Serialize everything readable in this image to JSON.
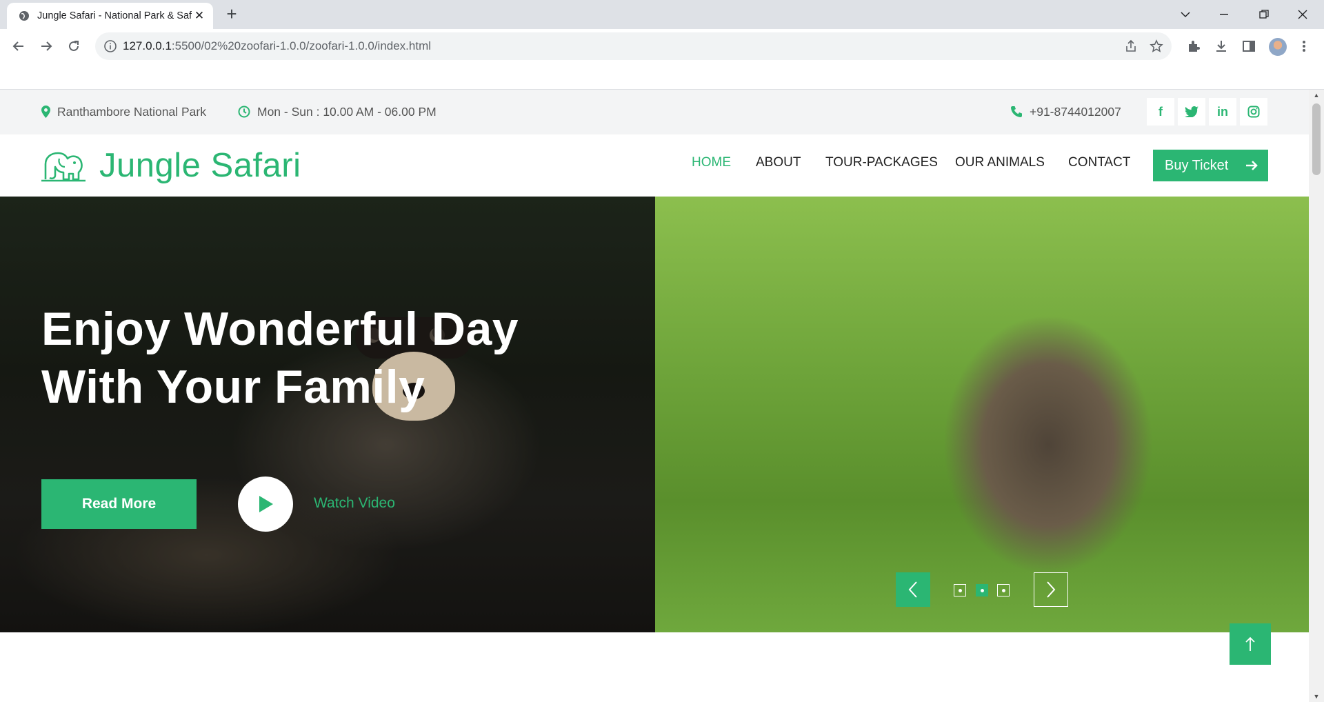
{
  "browser": {
    "tab_title": "Jungle Safari - National Park & Safari",
    "url_host": "127.0.0.1",
    "url_path": ":5500/02%20zoofari-1.0.0/zoofari-1.0.0/index.html"
  },
  "topbar": {
    "location": "Ranthambore National Park",
    "hours": "Mon - Sun : 10.00 AM - 06.00 PM",
    "phone": "+91-8744012007",
    "social": [
      {
        "icon": "facebook-icon",
        "glyph": "f"
      },
      {
        "icon": "twitter-icon",
        "glyph": ""
      },
      {
        "icon": "linkedin-icon",
        "glyph": "in"
      },
      {
        "icon": "instagram-icon",
        "glyph": ""
      }
    ]
  },
  "navbar": {
    "brand": "Jungle Safari",
    "links": [
      "HOME",
      "ABOUT",
      "TOUR-PACKAGES",
      "OUR ANIMALS",
      "CONTACT"
    ],
    "active": "HOME",
    "cta": "Buy Ticket"
  },
  "hero": {
    "title_line1": "Enjoy Wonderful Day",
    "title_line2": "With Your Family",
    "read_more": "Read More",
    "watch_video": "Watch Video",
    "active_slide": 2,
    "slide_count": 3
  },
  "colors": {
    "accent": "#2bb673",
    "topbar_bg": "#f3f4f5"
  }
}
